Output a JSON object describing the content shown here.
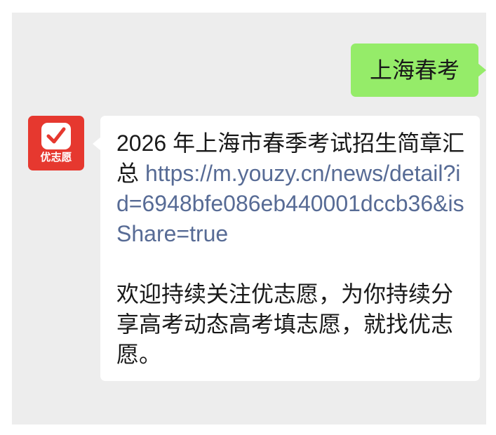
{
  "chat": {
    "outgoing": {
      "text": "上海春考"
    },
    "incoming": {
      "avatar": {
        "label": "优志愿",
        "icon": "check-icon"
      },
      "intro": "2026 年上海市春季考试招生简章汇总",
      "link": "https://m.youzy.cn/news/detail?id=6948bfe086eb440001dccb36&isShare=true",
      "footer": "欢迎持续关注优志愿，为你持续分享高考动态高考填志愿，就找优志愿。"
    }
  },
  "colors": {
    "chat_background": "#ededed",
    "outgoing_bubble": "#95ec69",
    "incoming_bubble": "#ffffff",
    "link": "#576b95",
    "avatar": "#e6382f"
  }
}
